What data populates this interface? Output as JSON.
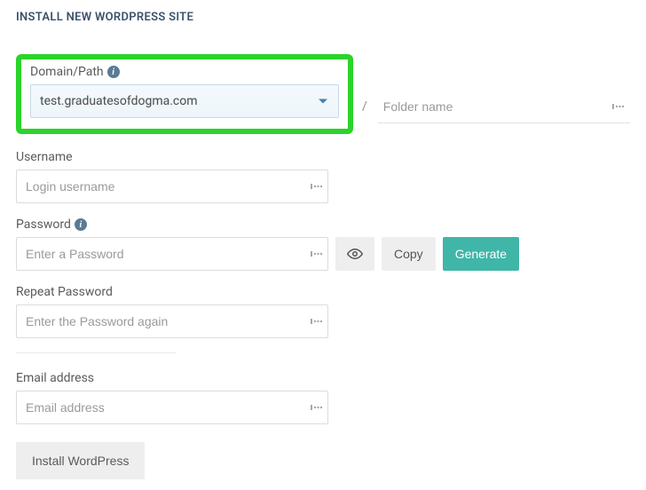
{
  "title": "INSTALL NEW WORDPRESS SITE",
  "domain": {
    "label": "Domain/Path",
    "selected": "test.graduatesofdogma.com",
    "folder_placeholder": "Folder name"
  },
  "username": {
    "label": "Username",
    "placeholder": "Login username"
  },
  "password": {
    "label": "Password",
    "placeholder": "Enter a Password",
    "copy_label": "Copy",
    "generate_label": "Generate"
  },
  "repeat_password": {
    "label": "Repeat Password",
    "placeholder": "Enter the Password again"
  },
  "email": {
    "label": "Email address",
    "placeholder": "Email address"
  },
  "install_label": "Install WordPress"
}
